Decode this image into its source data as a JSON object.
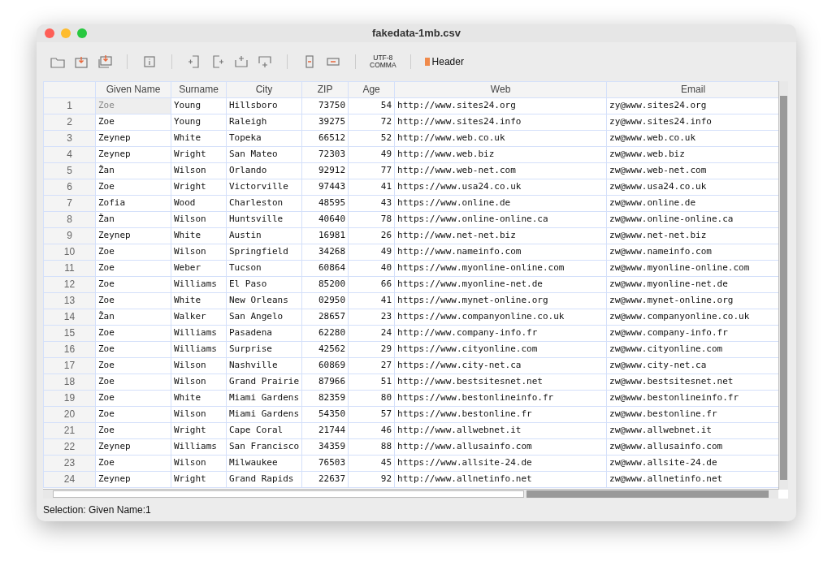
{
  "window": {
    "title": "fakedata-1mb.csv"
  },
  "toolbar": {
    "encoding": [
      "UTF-8",
      "COMMA"
    ],
    "header_toggle": {
      "label": "Header",
      "on": true
    }
  },
  "table": {
    "columns": [
      {
        "label": "Given Name",
        "selected": true,
        "kind": "text"
      },
      {
        "label": "Surname",
        "selected": false,
        "kind": "text"
      },
      {
        "label": "City",
        "selected": false,
        "kind": "text"
      },
      {
        "label": "ZIP",
        "selected": false,
        "kind": "number"
      },
      {
        "label": "Age",
        "selected": false,
        "kind": "number"
      },
      {
        "label": "Web",
        "selected": false,
        "kind": "text"
      },
      {
        "label": "Email",
        "selected": false,
        "kind": "text"
      }
    ],
    "rows": [
      {
        "number": "1",
        "selected": true,
        "cells": [
          "Zoe",
          "Young",
          "Hillsboro",
          "73750",
          "54",
          "http://www.sites24.org",
          "zy@www.sites24.org"
        ]
      },
      {
        "number": "2",
        "selected": false,
        "cells": [
          "Zoe",
          "Young",
          "Raleigh",
          "39275",
          "72",
          "http://www.sites24.info",
          "zy@www.sites24.info"
        ]
      },
      {
        "number": "3",
        "selected": false,
        "cells": [
          "Zeynep",
          "White",
          "Topeka",
          "66512",
          "52",
          "http://www.web.co.uk",
          "zw@www.web.co.uk"
        ]
      },
      {
        "number": "4",
        "selected": false,
        "cells": [
          "Zeynep",
          "Wright",
          "San Mateo",
          "72303",
          "49",
          "http://www.web.biz",
          "zw@www.web.biz"
        ]
      },
      {
        "number": "5",
        "selected": false,
        "cells": [
          "Žan",
          "Wilson",
          "Orlando",
          "92912",
          "77",
          "http://www.web-net.com",
          "zw@www.web-net.com"
        ]
      },
      {
        "number": "6",
        "selected": false,
        "cells": [
          "Zoe",
          "Wright",
          "Victorville",
          "97443",
          "41",
          "https://www.usa24.co.uk",
          "zw@www.usa24.co.uk"
        ]
      },
      {
        "number": "7",
        "selected": false,
        "cells": [
          "Zofia",
          "Wood",
          "Charleston",
          "48595",
          "43",
          "https://www.online.de",
          "zw@www.online.de"
        ]
      },
      {
        "number": "8",
        "selected": false,
        "cells": [
          "Žan",
          "Wilson",
          "Huntsville",
          "40640",
          "78",
          "https://www.online-online.ca",
          "zw@www.online-online.ca"
        ]
      },
      {
        "number": "9",
        "selected": false,
        "cells": [
          "Zeynep",
          "White",
          "Austin",
          "16981",
          "26",
          "http://www.net-net.biz",
          "zw@www.net-net.biz"
        ]
      },
      {
        "number": "10",
        "selected": false,
        "cells": [
          "Zoe",
          "Wilson",
          "Springfield",
          "34268",
          "49",
          "http://www.nameinfo.com",
          "zw@www.nameinfo.com"
        ]
      },
      {
        "number": "11",
        "selected": false,
        "cells": [
          "Zoe",
          "Weber",
          "Tucson",
          "60864",
          "40",
          "https://www.myonline-online.com",
          "zw@www.myonline-online.com"
        ]
      },
      {
        "number": "12",
        "selected": false,
        "cells": [
          "Zoe",
          "Williams",
          "El Paso",
          "85200",
          "66",
          "https://www.myonline-net.de",
          "zw@www.myonline-net.de"
        ]
      },
      {
        "number": "13",
        "selected": false,
        "cells": [
          "Zoe",
          "White",
          "New Orleans",
          "02950",
          "41",
          "https://www.mynet-online.org",
          "zw@www.mynet-online.org"
        ]
      },
      {
        "number": "14",
        "selected": false,
        "cells": [
          "Žan",
          "Walker",
          "San Angelo",
          "28657",
          "23",
          "https://www.companyonline.co.uk",
          "zw@www.companyonline.co.uk"
        ]
      },
      {
        "number": "15",
        "selected": false,
        "cells": [
          "Zoe",
          "Williams",
          "Pasadena",
          "62280",
          "24",
          "http://www.company-info.fr",
          "zw@www.company-info.fr"
        ]
      },
      {
        "number": "16",
        "selected": false,
        "cells": [
          "Zoe",
          "Williams",
          "Surprise",
          "42562",
          "29",
          "https://www.cityonline.com",
          "zw@www.cityonline.com"
        ]
      },
      {
        "number": "17",
        "selected": false,
        "cells": [
          "Zoe",
          "Wilson",
          "Nashville",
          "60869",
          "27",
          "https://www.city-net.ca",
          "zw@www.city-net.ca"
        ]
      },
      {
        "number": "18",
        "selected": false,
        "cells": [
          "Zoe",
          "Wilson",
          "Grand Prairie",
          "87966",
          "51",
          "http://www.bestsitesnet.net",
          "zw@www.bestsitesnet.net"
        ]
      },
      {
        "number": "19",
        "selected": false,
        "cells": [
          "Zoe",
          "White",
          "Miami Gardens",
          "82359",
          "80",
          "https://www.bestonlineinfo.fr",
          "zw@www.bestonlineinfo.fr"
        ]
      },
      {
        "number": "20",
        "selected": false,
        "cells": [
          "Zoe",
          "Wilson",
          "Miami Gardens",
          "54350",
          "57",
          "https://www.bestonline.fr",
          "zw@www.bestonline.fr"
        ]
      },
      {
        "number": "21",
        "selected": false,
        "cells": [
          "Zoe",
          "Wright",
          "Cape Coral",
          "21744",
          "46",
          "http://www.allwebnet.it",
          "zw@www.allwebnet.it"
        ]
      },
      {
        "number": "22",
        "selected": false,
        "cells": [
          "Zeynep",
          "Williams",
          "San Francisco",
          "34359",
          "88",
          "http://www.allusainfo.com",
          "zw@www.allusainfo.com"
        ]
      },
      {
        "number": "23",
        "selected": false,
        "cells": [
          "Zoe",
          "Wilson",
          "Milwaukee",
          "76503",
          "45",
          "https://www.allsite-24.de",
          "zw@www.allsite-24.de"
        ]
      },
      {
        "number": "24",
        "selected": false,
        "cells": [
          "Zeynep",
          "Wright",
          "Grand Rapids",
          "22637",
          "92",
          "http://www.allnetinfo.net",
          "zw@www.allnetinfo.net"
        ]
      }
    ]
  },
  "status_bar": {
    "text": "Selection: Given Name:1"
  }
}
